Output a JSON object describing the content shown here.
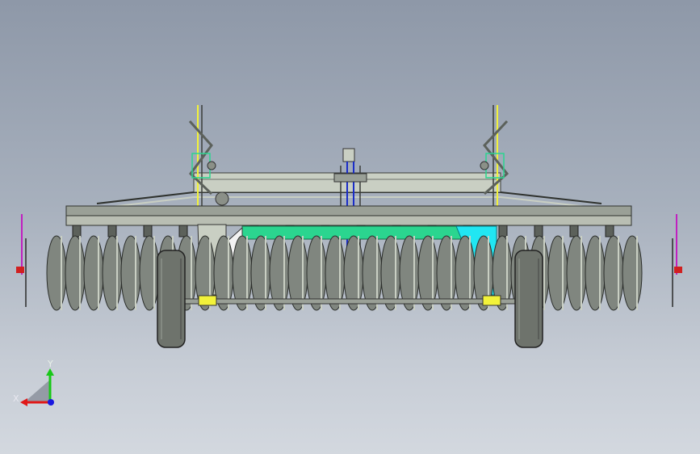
{
  "viewport": {
    "background_top": "#8e98a8",
    "background_bottom": "#d3d8df"
  },
  "colors": {
    "steel": "#9aa097",
    "steel_dark": "#3a3d3a",
    "disc": "#80867f",
    "frame": "#c9cfc3",
    "tire": "#6e736c",
    "accent_green": "#2bd58f",
    "accent_cyan": "#21e6f2",
    "accent_yellow": "#f2f23a",
    "accent_magenta": "#c020c0",
    "accent_blue": "#1a2cc8",
    "axis_x": "#e01818",
    "axis_y": "#18c818",
    "axis_z": "#1818e0"
  },
  "triad": {
    "x_label": "X",
    "y_label": "Y",
    "icon": "view-orientation-triad-icon"
  }
}
